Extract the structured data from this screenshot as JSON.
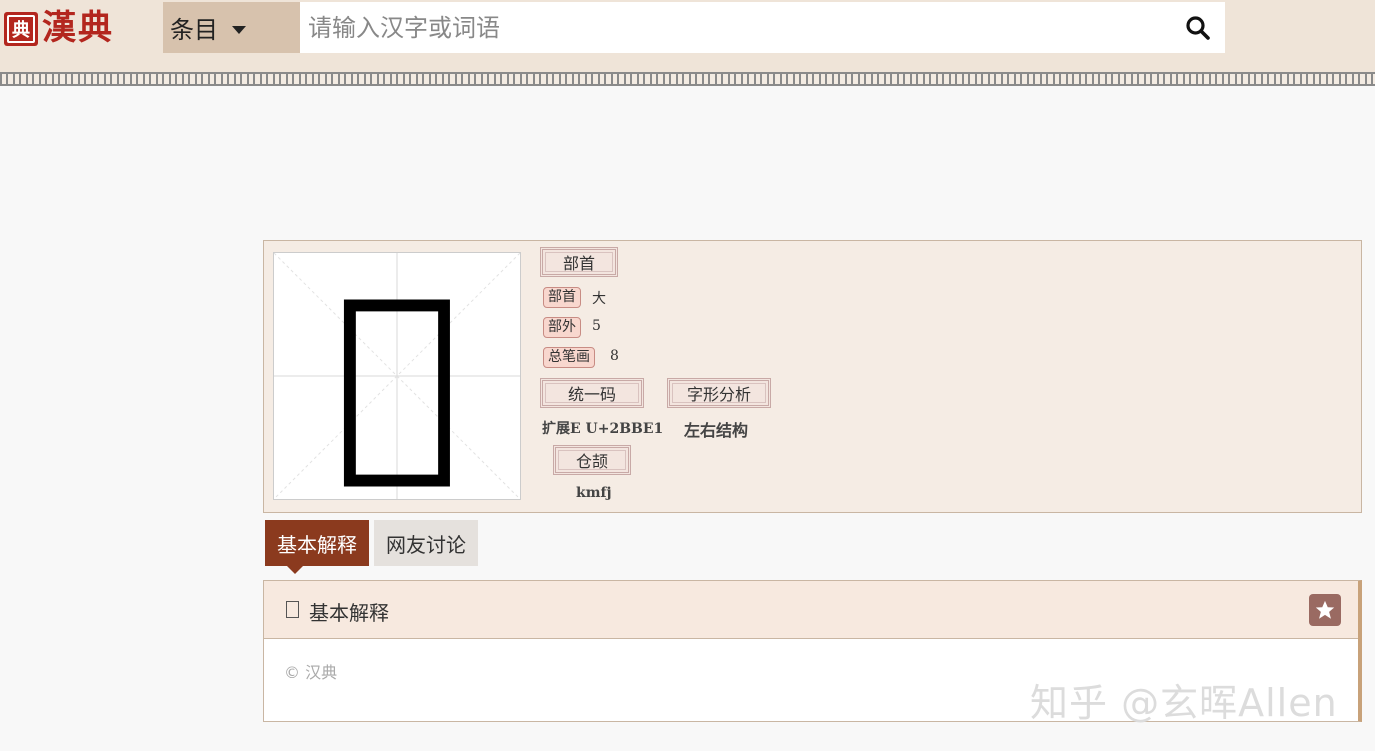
{
  "header": {
    "logo_seal": "典",
    "logo_text": "漢典",
    "search_type": "条目",
    "search_placeholder": "请输入汉字或词语",
    "search_icon": "search-icon"
  },
  "character": {
    "glyph": "𫮡",
    "radical_section": "部首",
    "radical_label": "部首",
    "radical_value": "大",
    "outside_label": "部外",
    "outside_value": "5",
    "strokes_label": "总笔画",
    "strokes_value": "8",
    "unicode_section": "统一码",
    "unicode_value": "扩展E U+2BBE1",
    "structure_section": "字形分析",
    "structure_value": "左右结构",
    "cangjie_section": "仓颉",
    "cangjie_value": "kmfj"
  },
  "tabs": [
    {
      "label": "基本解释",
      "active": true
    },
    {
      "label": "网友讨论",
      "active": false
    }
  ],
  "panel": {
    "title": "基本解释",
    "star_icon": "star-icon",
    "copyright": "© 汉典"
  },
  "watermark": "知乎 @玄晖Allen",
  "colors": {
    "brand_red": "#b3261e",
    "tab_active": "#8b3a1e",
    "pill_bg": "#f8d7ce"
  }
}
